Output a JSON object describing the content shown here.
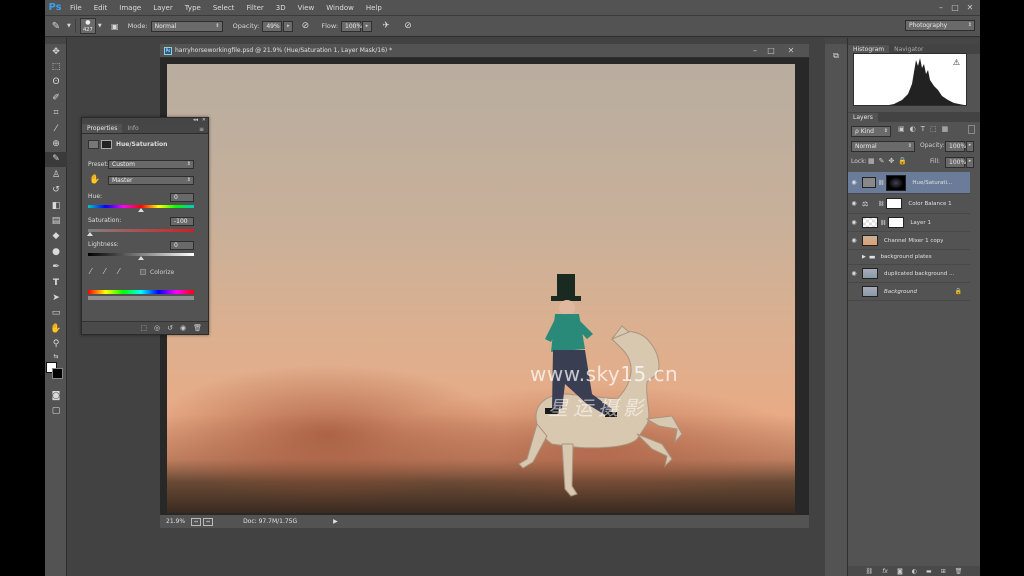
{
  "app": {
    "logo": "Ps",
    "menu": [
      "File",
      "Edit",
      "Image",
      "Layer",
      "Type",
      "Select",
      "Filter",
      "3D",
      "View",
      "Window",
      "Help"
    ],
    "window_controls": [
      "–",
      "□",
      "✕"
    ]
  },
  "options_bar": {
    "brush_size": "427",
    "mode_label": "Mode:",
    "mode_value": "Normal",
    "opacity_label": "Opacity:",
    "opacity_value": "49%",
    "flow_label": "Flow:",
    "flow_value": "100%",
    "workspace": "Photography"
  },
  "document": {
    "title": "harryhorseworkingfile.psd @ 21.9% (Hue/Saturation 1, Layer Mask/16) *",
    "zoom": "21.9%",
    "doc_size": "Doc: 97.7M/1.75G"
  },
  "properties": {
    "tabs": [
      "Properties",
      "Info"
    ],
    "heading": "Hue/Saturation",
    "preset_label": "Preset:",
    "preset_value": "Custom",
    "channel_value": "Master",
    "hue_label": "Hue:",
    "hue_value": "0",
    "saturation_label": "Saturation:",
    "saturation_value": "-100",
    "lightness_label": "Lightness:",
    "lightness_value": "0",
    "colorize_label": "Colorize"
  },
  "panels": {
    "histogram_tabs": [
      "Histogram",
      "Navigator"
    ],
    "layers_tab": "Layers",
    "kind_label": "ρ Kind",
    "blend_mode": "Normal",
    "opacity_label": "Opacity:",
    "opacity_value": "100%",
    "lock_label": "Lock:",
    "fill_label": "Fill:",
    "fill_value": "100%"
  },
  "layers": [
    {
      "name": "Hue/Saturati...",
      "selected": true
    },
    {
      "name": "Color Balance 1",
      "selected": false
    },
    {
      "name": "Layer 1",
      "selected": false
    },
    {
      "name": "Channel Mixer 1 copy",
      "selected": false
    },
    {
      "name": "background plates",
      "selected": false
    },
    {
      "name": "duplicated background ...",
      "selected": false
    },
    {
      "name": "Background",
      "selected": false
    }
  ],
  "watermark": {
    "url": "www.sky15.cn",
    "text": "星运摄影"
  }
}
